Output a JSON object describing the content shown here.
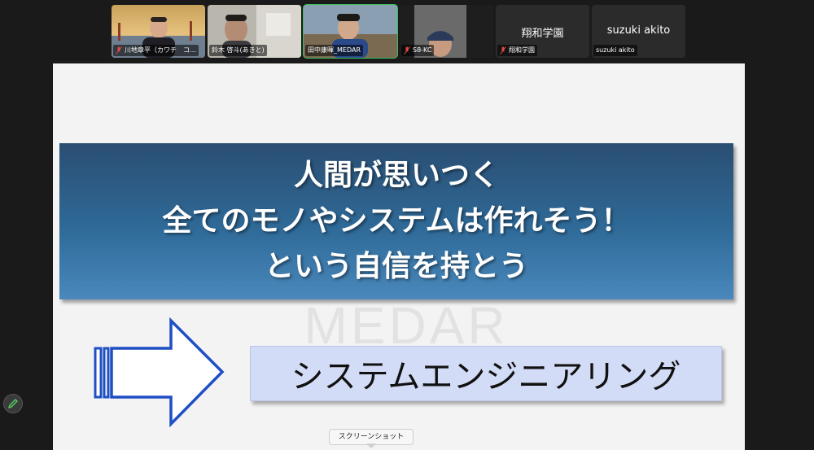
{
  "participants": [
    {
      "label": "川地章平（カワチ　コ…",
      "muted": true,
      "video": true
    },
    {
      "label": "鈴木 啓斗(あきと)",
      "muted": false,
      "video": true
    },
    {
      "label": "田中康暉_MEDAR",
      "muted": false,
      "video": true,
      "active": true
    },
    {
      "label": "S8-KC",
      "muted": true,
      "video": true
    },
    {
      "label": "翔和学園",
      "muted": true,
      "video": false,
      "name_display": "翔和学園"
    },
    {
      "label": "suzuki akito",
      "muted": false,
      "video": false,
      "name_display": "suzuki akito"
    }
  ],
  "slide": {
    "banner_lines": [
      "人間が思いつく",
      "全てのモノやシステムは作れそう！",
      "という自信を持とう"
    ],
    "box_text": "システムエンジニアリング",
    "watermark": "MEDAR"
  },
  "tooltip": "スクリーンショット",
  "colors": {
    "active_speaker": "#39c15a",
    "banner_top": "#2a4e72",
    "banner_bottom": "#4a88bc",
    "box_fill": "#d3dcf6",
    "arrow_stroke": "#1f4fc4"
  },
  "icons": {
    "mic_off": "mic-off-icon",
    "annotate": "pencil-icon"
  }
}
